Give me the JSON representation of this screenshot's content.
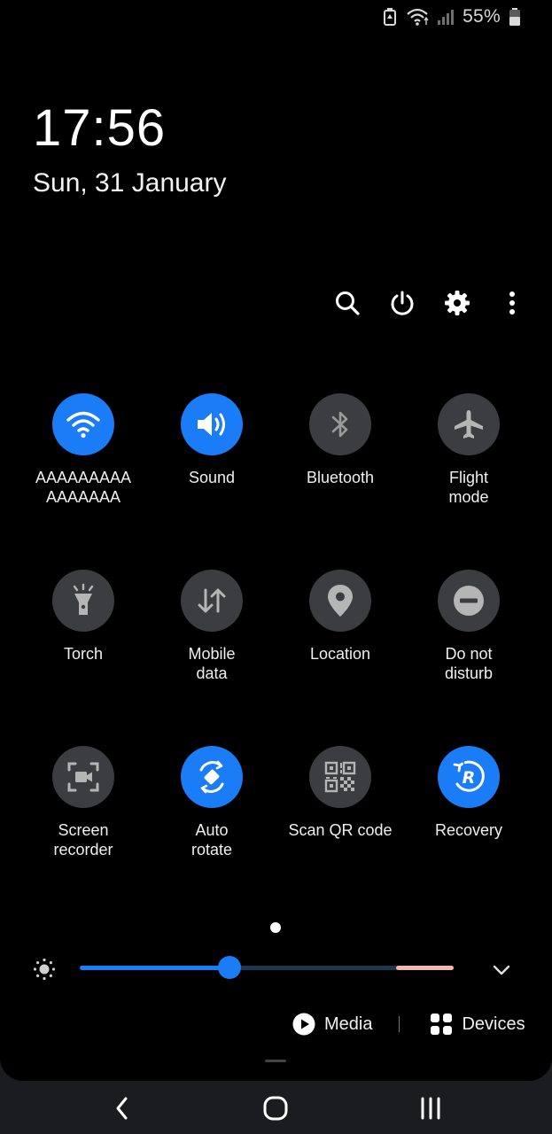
{
  "status_bar": {
    "battery_percent": "55%"
  },
  "clock": {
    "time": "17:56",
    "date": "Sun, 31 January"
  },
  "header_actions": [
    {
      "icon": "search-icon"
    },
    {
      "icon": "power-icon"
    },
    {
      "icon": "gear-icon"
    },
    {
      "icon": "more-vertical-icon"
    }
  ],
  "tiles": [
    {
      "label": "AAAAAAAAA\nAAAAAAA",
      "icon": "wifi-icon",
      "state": "on"
    },
    {
      "label": "Sound",
      "icon": "speaker-icon",
      "state": "on"
    },
    {
      "label": "Bluetooth",
      "icon": "bluetooth-icon",
      "state": "off"
    },
    {
      "label": "Flight\nmode",
      "icon": "airplane-icon",
      "state": "off"
    },
    {
      "label": "Torch",
      "icon": "torch-icon",
      "state": "off"
    },
    {
      "label": "Mobile\ndata",
      "icon": "mobile-data-icon",
      "state": "off"
    },
    {
      "label": "Location",
      "icon": "location-pin-icon",
      "state": "off"
    },
    {
      "label": "Do not\ndisturb",
      "icon": "do-not-disturb-icon",
      "state": "off"
    },
    {
      "label": "Screen\nrecorder",
      "icon": "screen-recorder-icon",
      "state": "off"
    },
    {
      "label": "Auto\nrotate",
      "icon": "auto-rotate-icon",
      "state": "on"
    },
    {
      "label": "Scan QR code",
      "icon": "qr-code-icon",
      "state": "off"
    },
    {
      "label": "Recovery",
      "icon": "recovery-icon",
      "state": "on"
    }
  ],
  "brightness": {
    "level": 0.4
  },
  "media_row": {
    "media_label": "Media",
    "devices_label": "Devices"
  },
  "colors": {
    "accent": "#1a7cf6",
    "tile_off": "#3c3d40",
    "background": "#000000"
  }
}
